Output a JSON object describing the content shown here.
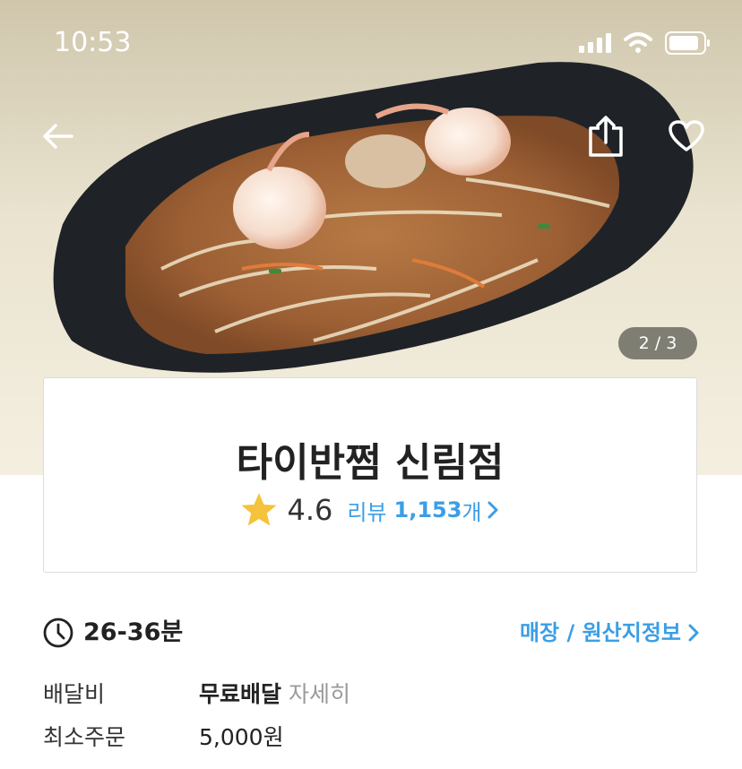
{
  "status_bar": {
    "time": "10:53"
  },
  "hero": {
    "page_indicator": "2 / 3"
  },
  "store": {
    "name": "타이반쩜 신림점",
    "rating": "4.6",
    "review_label": "리뷰",
    "review_count": "1,153",
    "review_unit": "개"
  },
  "delivery": {
    "time": "26-36분",
    "store_info_link": "매장 / 원산지정보"
  },
  "details": {
    "fee_label": "배달비",
    "fee_value": "무료배달",
    "fee_detail": "자세히",
    "min_order_label": "최소주문",
    "min_order_value": "5,000원"
  },
  "colors": {
    "accent": "#3b9ee6",
    "star": "#f5c33b"
  }
}
